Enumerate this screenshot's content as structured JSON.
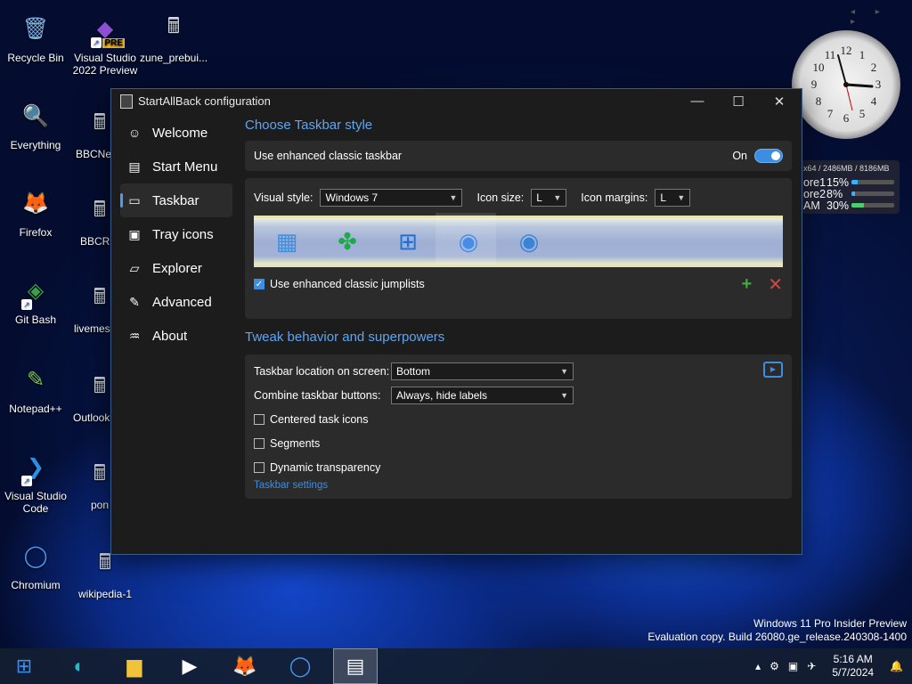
{
  "desktop": {
    "icons": [
      {
        "label": "Recycle Bin",
        "glyph": "🗑",
        "color": "#7fb6e8"
      },
      {
        "label": "Visual Studio 2022 Preview",
        "glyph": "◆",
        "color": "#8d4fd3",
        "badge": "PRE"
      },
      {
        "label": "zune_prebui...",
        "glyph": "🖩",
        "color": "#cfd6df"
      },
      {
        "label": "Everything",
        "glyph": "🔍",
        "color": "#f07d1e"
      },
      {
        "label": "BBCNe",
        "glyph": "🖩",
        "color": "#cfd6df"
      },
      {
        "label": "Firefox",
        "glyph": "🦊",
        "color": "#f05a26"
      },
      {
        "label": "BBCRa",
        "glyph": "🖩",
        "color": "#cfd6df"
      },
      {
        "label": "Git Bash",
        "glyph": "◈",
        "color": "#3aa04a"
      },
      {
        "label": "livemes",
        "glyph": "🖩",
        "color": "#cfd6df"
      },
      {
        "label": "Notepad++",
        "glyph": "✎",
        "color": "#7ec65a"
      },
      {
        "label": "Outlook",
        "glyph": "🖩",
        "color": "#cfd6df"
      },
      {
        "label": "Visual Studio Code",
        "glyph": "❯",
        "color": "#2a8ee6"
      },
      {
        "label": "pon",
        "glyph": "🖩",
        "color": "#cfd6df"
      },
      {
        "label": "Chromium",
        "glyph": "◯",
        "color": "#4a9af0"
      },
      {
        "label": "wikipedia-1",
        "glyph": "🖩",
        "color": "#cfd6df"
      }
    ],
    "cpu_gadget": {
      "header": "x64 / 2486MB / 8186MB",
      "rows": [
        {
          "label": "ore1",
          "value": "15%",
          "pct": 15
        },
        {
          "label": "ore2",
          "value": "8%",
          "pct": 8
        },
        {
          "label": "AM",
          "value": "30%",
          "pct": 30
        }
      ]
    },
    "gadget_nav": "◂ ▸ ▸",
    "clock_numbers": [
      "12",
      "1",
      "2",
      "3",
      "4",
      "5",
      "6",
      "7",
      "8",
      "9",
      "10",
      "11"
    ],
    "watermark": {
      "line1": "Windows 11 Pro Insider Preview",
      "line2": "Evaluation copy. Build 26080.ge_release.240308-1400"
    }
  },
  "window": {
    "title": "StartAllBack configuration",
    "controls": {
      "minimize": "—",
      "maximize": "☐",
      "close": "✕"
    },
    "nav": [
      {
        "label": "Welcome",
        "icon": "☺"
      },
      {
        "label": "Start Menu",
        "icon": "▤"
      },
      {
        "label": "Taskbar",
        "icon": "▭"
      },
      {
        "label": "Tray icons",
        "icon": "▣"
      },
      {
        "label": "Explorer",
        "icon": "▱"
      },
      {
        "label": "Advanced",
        "icon": "✎"
      },
      {
        "label": "About",
        "icon": "♒"
      }
    ],
    "section1": {
      "title": "Choose Taskbar style",
      "enhanced_label": "Use enhanced classic taskbar",
      "toggle_state": "On",
      "visual_style_label": "Visual style:",
      "visual_style_value": "Windows 7",
      "icon_size_label": "Icon size:",
      "icon_size_value": "L",
      "icon_margins_label": "Icon margins:",
      "icon_margins_value": "L",
      "jumplists_label": "Use enhanced classic jumplists",
      "add_symbol": "+",
      "remove_symbol": "✕",
      "preview_icons": [
        "▦",
        "✤",
        "⊞",
        "◉",
        "◉"
      ]
    },
    "section2": {
      "title": "Tweak behavior and superpowers",
      "location_label": "Taskbar location on screen:",
      "location_value": "Bottom",
      "combine_label": "Combine taskbar buttons:",
      "combine_value": "Always, hide labels",
      "centered_label": "Centered task icons",
      "segments_label": "Segments",
      "dynamic_label": "Dynamic transparency",
      "settings_link": "Taskbar settings"
    }
  },
  "taskbar": {
    "apps": [
      "⊞",
      "◐",
      "▆",
      "▶",
      "🦊",
      "◯",
      "▤"
    ],
    "tray_icons": [
      "▴",
      "⚙",
      "▣",
      "✈",
      "🔔"
    ],
    "time": "5:16 AM",
    "date": "5/7/2024"
  },
  "colors": {
    "accent": "#5fa5ef",
    "toggle": "#3d8ee0",
    "add": "#39b03a",
    "remove": "#d9443b"
  }
}
